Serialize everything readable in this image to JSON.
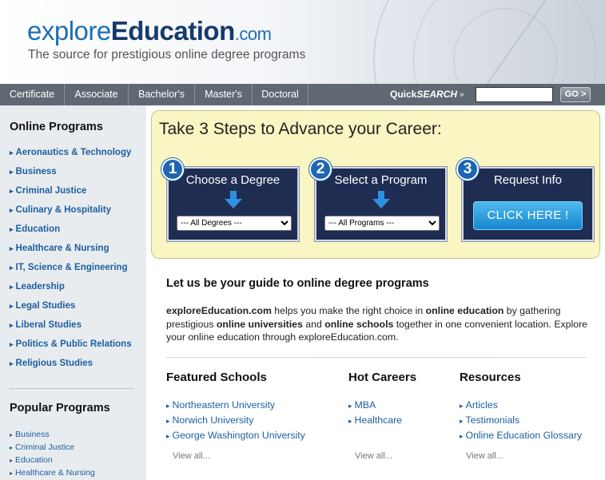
{
  "header": {
    "logo_part1": "explore",
    "logo_part2": "Education",
    "logo_part3": ".com",
    "tagline": "The source for prestigious online degree programs"
  },
  "nav": {
    "tabs": [
      "Certificate",
      "Associate",
      "Bachelor's",
      "Master's",
      "Doctoral"
    ],
    "quicksearch_prefix": "Quick",
    "quicksearch_italic": "SEARCH",
    "quicksearch_arrow": "»",
    "search_value": "",
    "go_label": "GO >"
  },
  "sidebar": {
    "online_title": "Online Programs",
    "online_items": [
      "Aeronautics & Technology",
      "Business",
      "Criminal Justice",
      "Culinary & Hospitality",
      "Education",
      "Healthcare & Nursing",
      "IT, Science & Engineering",
      "Leadership",
      "Legal Studies",
      "Liberal Studies",
      "Politics & Public Relations",
      "Religious Studies"
    ],
    "popular_title": "Popular Programs",
    "popular_items": [
      "Business",
      "Criminal Justice",
      "Education",
      "Healthcare & Nursing"
    ]
  },
  "steps": {
    "title": "Take 3 Steps to Advance your Career:",
    "step1": {
      "number": "1",
      "title": "Choose a Degree",
      "select_value": "--- All Degrees ---"
    },
    "step2": {
      "number": "2",
      "title": "Select a Program",
      "select_value": "--- All Programs ---"
    },
    "step3": {
      "number": "3",
      "title": "Request Info",
      "button": "CLICK HERE !"
    }
  },
  "main": {
    "guide_title": "Let us be your guide to online degree programs",
    "intro": {
      "brand": "exploreEducation.com",
      "t1": " helps you make the right choice in ",
      "b1": "online education",
      "t2": " by gathering prestigious ",
      "b2": "online universities",
      "t3": " and ",
      "b3": "online schools",
      "t4": " together in one convenient location. Explore your online education through exploreEducation.com."
    },
    "featured": {
      "title": "Featured Schools",
      "links": [
        "Northeastern University",
        "Norwich University",
        "George Washington University"
      ],
      "view_all": "View all..."
    },
    "careers": {
      "title": "Hot Careers",
      "links": [
        "MBA",
        "Healthcare"
      ],
      "view_all": "View all..."
    },
    "resources": {
      "title": "Resources",
      "links": [
        "Articles",
        "Testimonials",
        "Online Education Glossary"
      ],
      "view_all": "View all..."
    }
  },
  "colors": {
    "nav_bg": "#5f6873",
    "sidebar_bg": "#e9ecef",
    "steps_bg": "#faf6c3",
    "step_box": "#1f2d53",
    "link": "#1d5fa0",
    "logo_blue": "#1d6fb4",
    "logo_navy": "#163a6b"
  }
}
